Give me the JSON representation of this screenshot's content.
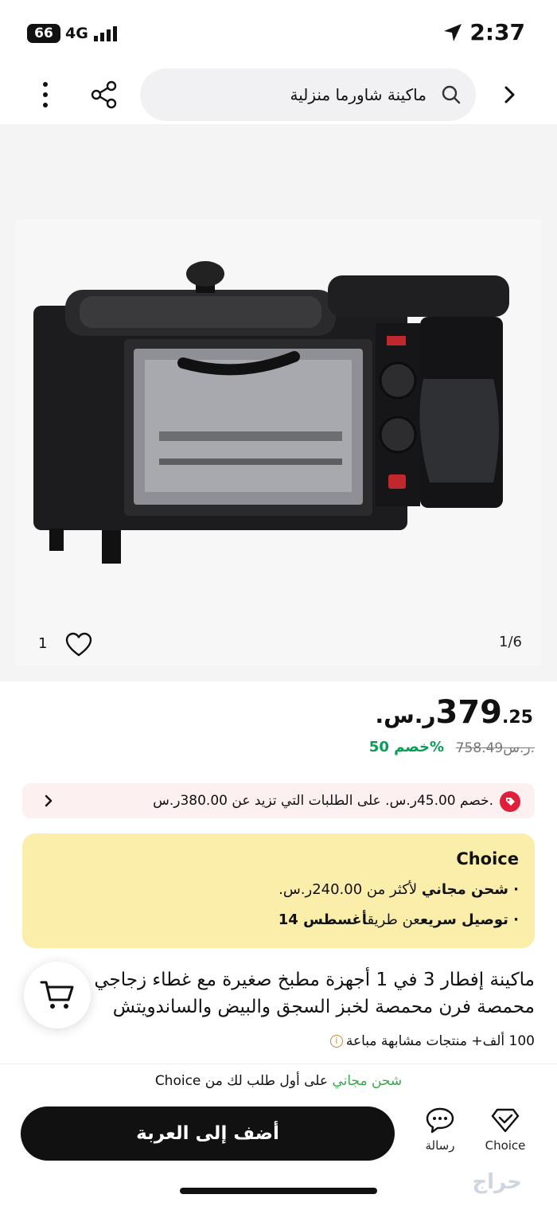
{
  "status_bar": {
    "battery": "66",
    "network": "4G",
    "time": "2:37"
  },
  "search": {
    "query": "ماكينة شاورما منزلية"
  },
  "gallery": {
    "pager": "1/6",
    "favorites_count": "1"
  },
  "price": {
    "major": "379",
    "minor": ".25",
    "currency": "ر.س.",
    "original": "758.49ر.س.",
    "discount": "خصم 50%"
  },
  "coupon": {
    "text": "خصم 45.00ر.س. على الطلبات التي تزيد عن 380.00ر.س."
  },
  "choice_box": {
    "brand": "Choice",
    "line1_bold": "· شحن مجاني",
    "line1_rest": " لأكثر من 240.00ر.س.",
    "line2_bold": "· توصيل سريع",
    "line2_mid": "عن طريق",
    "line2_date": "أغسطس 14"
  },
  "product": {
    "title_line1": "ماكينة إفطار 3 في 1 أجهزة مطبخ صغيرة مع غطاء زجاجي",
    "title_line2": "محمصة فرن محمصة لخبز السجق والبيض والساندويتش",
    "sold": "100 ألف+ منتجات مشابهة مباعة"
  },
  "bottom": {
    "ship_green": "شحن مجاني",
    "ship_rest": " على أول طلب لك من Choice",
    "add_to_cart": "أضف إلى العربة",
    "message_label": "رسالة",
    "choice_label": "Choice",
    "watermark": "حراج"
  },
  "colors": {
    "choice_bg": "#fbeeaa",
    "discount_green": "#0a9d58",
    "coupon_bg": "#fdf0f1",
    "tag_red": "#e0203a"
  }
}
